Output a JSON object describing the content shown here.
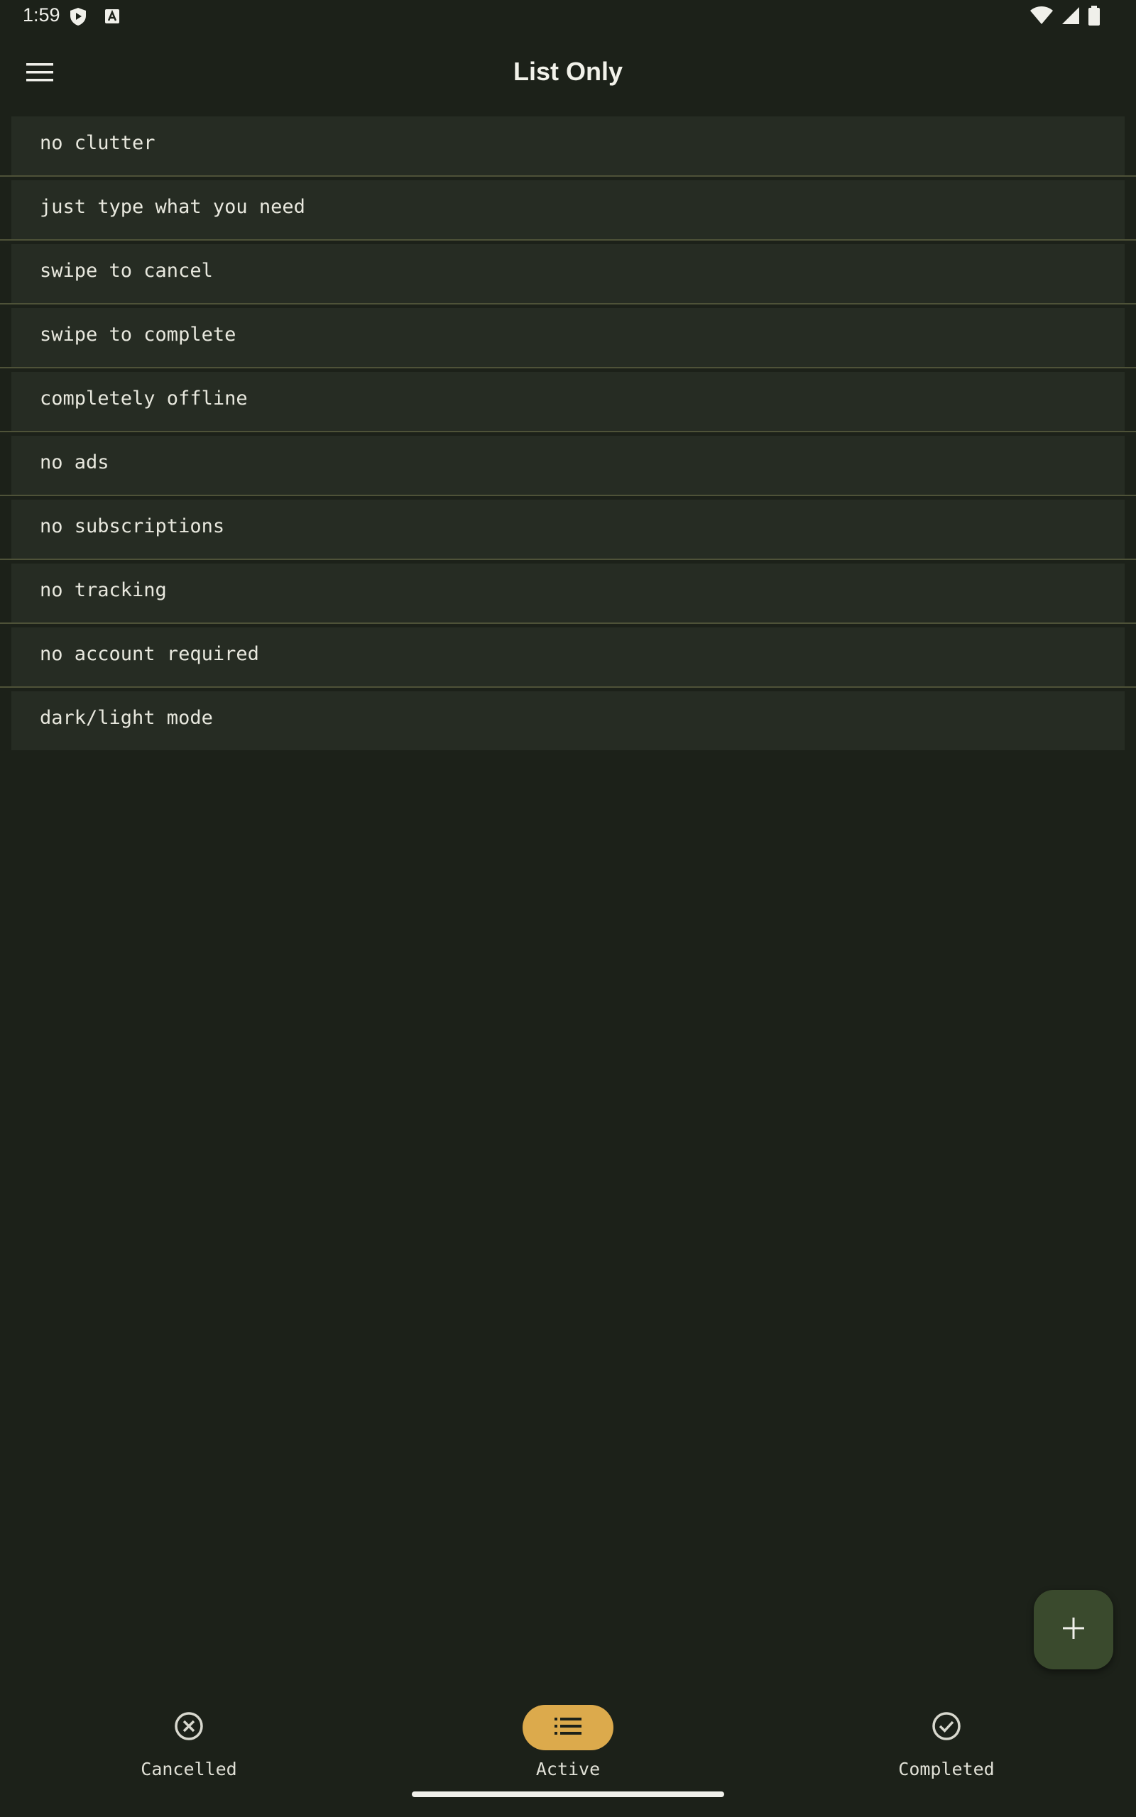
{
  "status_bar": {
    "time": "1:59",
    "icons": [
      "play-protect-icon",
      "keyboard-a-icon",
      "wifi-icon",
      "cell-signal-icon",
      "battery-icon"
    ]
  },
  "app_bar": {
    "title": "List Only",
    "menu_icon": "hamburger-menu-icon"
  },
  "tasks": [
    "no clutter",
    "just type what you need",
    "swipe to cancel",
    "swipe to complete",
    "completely offline",
    "no ads",
    "no subscriptions",
    "no tracking",
    "no account required",
    "dark/light mode"
  ],
  "fab": {
    "icon": "plus-icon"
  },
  "bottom_nav": {
    "items": [
      {
        "label": "Cancelled",
        "icon": "cancel-circle-icon",
        "active": false
      },
      {
        "label": "Active",
        "icon": "list-icon",
        "active": true
      },
      {
        "label": "Completed",
        "icon": "check-circle-icon",
        "active": false
      }
    ]
  },
  "colors": {
    "background": "#1c2119",
    "card": "#262c23",
    "divider": "#4e5238",
    "accent": "#dcaa4c",
    "fab": "#3a4a2d"
  }
}
